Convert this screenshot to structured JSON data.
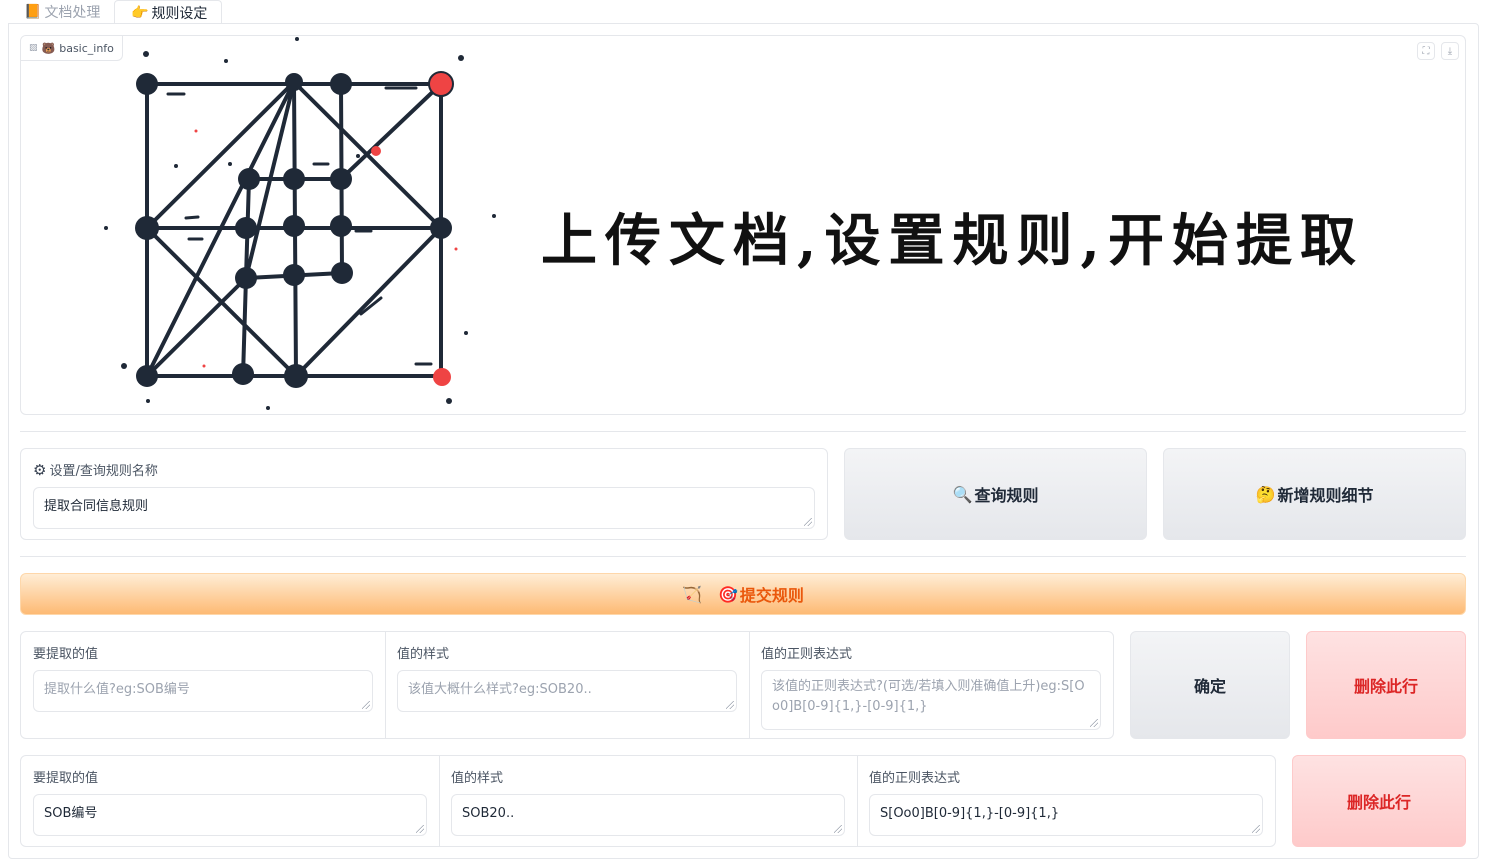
{
  "tabs": [
    {
      "icon": "📙",
      "label": "文档处理"
    },
    {
      "icon": "👉",
      "label": "规则设定"
    }
  ],
  "image_panel": {
    "label_icon": "🐻",
    "label": "basic_info",
    "banner_text": "上传文档,设置规则,开始提取"
  },
  "rule_name": {
    "icon": "⚙",
    "label": "设置/查询规则名称",
    "value": "提取合同信息规则"
  },
  "buttons": {
    "query": {
      "icon": "🔍",
      "label": "查询规则"
    },
    "add_detail": {
      "icon": "🤔",
      "label": "新增规则细节"
    },
    "submit": {
      "icon1": "🏹",
      "icon2": "🎯",
      "label": "提交规则"
    },
    "confirm": "确定",
    "delete_row": "删除此行"
  },
  "new_row": {
    "labels": [
      "要提取的值",
      "值的样式",
      "值的正则表达式"
    ],
    "placeholders": [
      "提取什么值?eg:SOB编号",
      "该值大概什么样式?eg:SOB20..",
      "该值的正则表达式?(可选/若填入则准确值上升)eg:S[Oo0]B[0-9]{1,}-[0-9]{1,}"
    ]
  },
  "rows": [
    {
      "labels": [
        "要提取的值",
        "值的样式",
        "值的正则表达式"
      ],
      "values": [
        "SOB编号",
        "SOB20..",
        "S[Oo0]B[0-9]{1,}-[0-9]{1,}"
      ]
    }
  ]
}
